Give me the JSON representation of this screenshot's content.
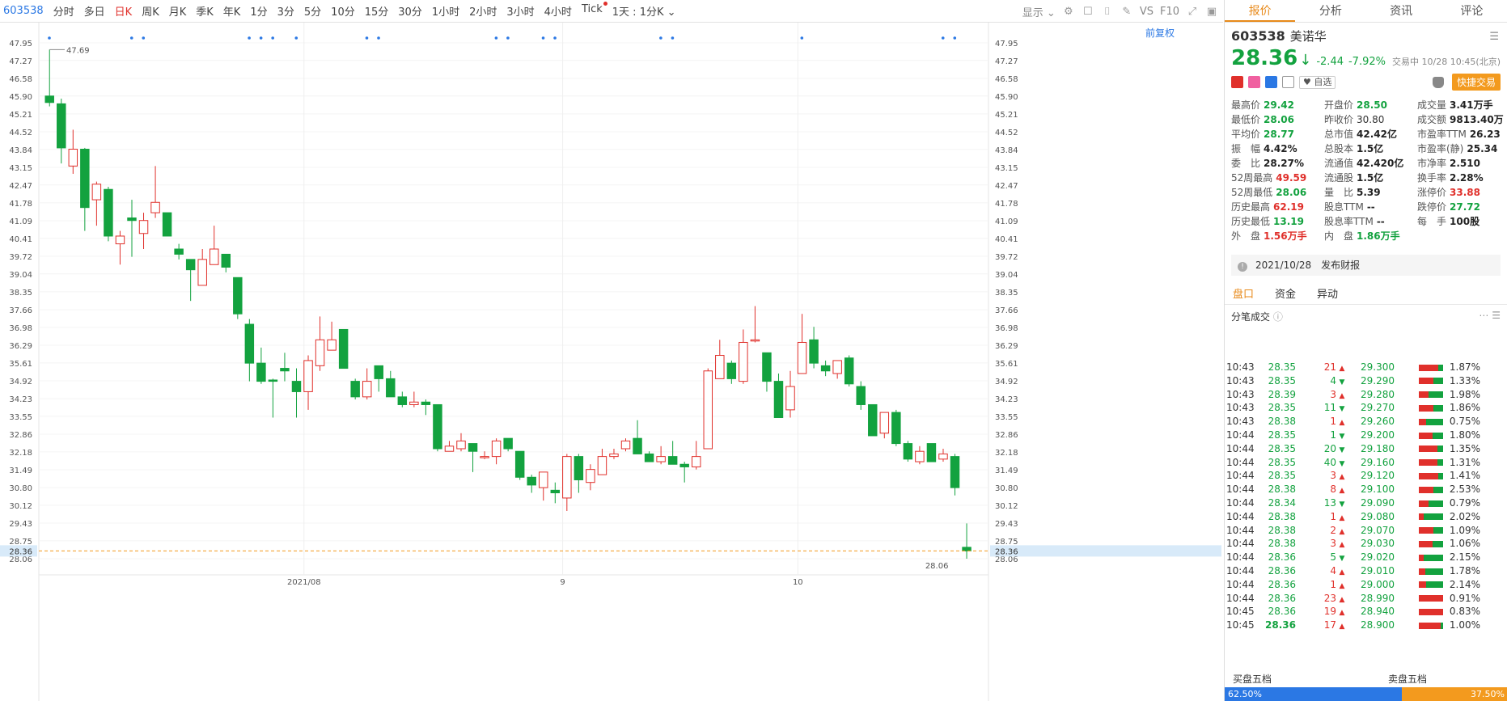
{
  "toolbar": {
    "code": "603538",
    "periods": [
      "分时",
      "多日",
      "日K",
      "周K",
      "月K",
      "季K",
      "年K",
      "1分",
      "3分",
      "5分",
      "10分",
      "15分",
      "30分",
      "1小时",
      "2小时",
      "3小时",
      "4小时",
      "Tick"
    ],
    "active_period": "日K",
    "dotted_periods": [
      "Tick"
    ],
    "interval": "1天 : 1分K",
    "display_label": "显示",
    "vs_label": "VS",
    "f10_label": "F10"
  },
  "chart": {
    "restore_label": "前复权",
    "axis_levels": [
      "47.95",
      "47.27",
      "46.58",
      "45.90",
      "45.21",
      "44.52",
      "43.84",
      "43.15",
      "42.47",
      "41.78",
      "41.09",
      "40.41",
      "39.72",
      "39.04",
      "38.35",
      "37.66",
      "36.98",
      "36.29",
      "35.61",
      "34.92",
      "34.23",
      "33.55",
      "32.86",
      "32.18",
      "31.49",
      "30.80",
      "30.12",
      "29.43",
      "28.75",
      "28.06"
    ],
    "current_price_label": "28.36",
    "max_label": "47.69",
    "min_label": "28.06",
    "date_labels": [
      {
        "text": "2021/08",
        "index": 22
      },
      {
        "text": "9",
        "index": 44
      },
      {
        "text": "10",
        "index": 64
      }
    ]
  },
  "chart_data": {
    "type": "candlestick",
    "ylim": [
      28.06,
      47.95
    ],
    "current_price": 28.36,
    "candles": [
      {
        "o": 45.9,
        "c": 45.65,
        "h": 47.69,
        "l": 45.5
      },
      {
        "o": 45.6,
        "c": 43.9,
        "h": 45.8,
        "l": 43.3
      },
      {
        "o": 43.2,
        "c": 43.85,
        "h": 44.6,
        "l": 42.9
      },
      {
        "o": 43.85,
        "c": 41.6,
        "h": 43.9,
        "l": 40.7
      },
      {
        "o": 41.9,
        "c": 42.5,
        "h": 42.6,
        "l": 40.9
      },
      {
        "o": 42.3,
        "c": 40.5,
        "h": 42.4,
        "l": 40.3
      },
      {
        "o": 40.2,
        "c": 40.5,
        "h": 40.7,
        "l": 39.4
      },
      {
        "o": 41.2,
        "c": 41.1,
        "h": 41.9,
        "l": 39.7
      },
      {
        "o": 40.6,
        "c": 41.1,
        "h": 41.4,
        "l": 40.0
      },
      {
        "o": 41.4,
        "c": 41.8,
        "h": 43.2,
        "l": 41.2
      },
      {
        "o": 41.4,
        "c": 40.5,
        "h": 41.4,
        "l": 40.5
      },
      {
        "o": 40.0,
        "c": 39.8,
        "h": 40.2,
        "l": 39.6
      },
      {
        "o": 39.6,
        "c": 39.2,
        "h": 39.6,
        "l": 38.0
      },
      {
        "o": 38.6,
        "c": 39.6,
        "h": 40.0,
        "l": 38.6
      },
      {
        "o": 39.4,
        "c": 40.0,
        "h": 40.9,
        "l": 39.4
      },
      {
        "o": 39.8,
        "c": 39.3,
        "h": 39.8,
        "l": 39.1
      },
      {
        "o": 38.9,
        "c": 37.5,
        "h": 38.9,
        "l": 37.3
      },
      {
        "o": 37.1,
        "c": 35.6,
        "h": 37.3,
        "l": 34.9
      },
      {
        "o": 35.6,
        "c": 34.9,
        "h": 36.2,
        "l": 34.8
      },
      {
        "o": 34.95,
        "c": 34.9,
        "h": 35.0,
        "l": 33.5
      },
      {
        "o": 35.4,
        "c": 35.3,
        "h": 36.0,
        "l": 34.9
      },
      {
        "o": 34.9,
        "c": 34.5,
        "h": 35.4,
        "l": 33.5
      },
      {
        "o": 34.5,
        "c": 35.7,
        "h": 35.9,
        "l": 33.8
      },
      {
        "o": 35.5,
        "c": 36.5,
        "h": 37.4,
        "l": 35.3
      },
      {
        "o": 36.1,
        "c": 36.5,
        "h": 37.2,
        "l": 36.1
      },
      {
        "o": 36.9,
        "c": 35.4,
        "h": 36.9,
        "l": 35.4
      },
      {
        "o": 34.9,
        "c": 34.3,
        "h": 35.0,
        "l": 34.2
      },
      {
        "o": 34.3,
        "c": 34.9,
        "h": 35.4,
        "l": 34.2
      },
      {
        "o": 35.5,
        "c": 35.0,
        "h": 35.5,
        "l": 34.5
      },
      {
        "o": 35.0,
        "c": 34.3,
        "h": 35.3,
        "l": 34.3
      },
      {
        "o": 34.3,
        "c": 34.0,
        "h": 34.5,
        "l": 33.9
      },
      {
        "o": 34.0,
        "c": 34.1,
        "h": 34.5,
        "l": 33.9
      },
      {
        "o": 34.1,
        "c": 34.0,
        "h": 34.2,
        "l": 33.6
      },
      {
        "o": 34.0,
        "c": 32.3,
        "h": 34.0,
        "l": 32.2
      },
      {
        "o": 32.2,
        "c": 32.4,
        "h": 32.6,
        "l": 32.2
      },
      {
        "o": 32.3,
        "c": 32.6,
        "h": 32.9,
        "l": 32.2
      },
      {
        "o": 32.5,
        "c": 32.2,
        "h": 32.5,
        "l": 31.4
      },
      {
        "o": 32.0,
        "c": 32.0,
        "h": 32.2,
        "l": 31.9
      },
      {
        "o": 32.0,
        "c": 32.6,
        "h": 32.7,
        "l": 31.7
      },
      {
        "o": 32.7,
        "c": 32.3,
        "h": 32.7,
        "l": 32.2
      },
      {
        "o": 32.2,
        "c": 31.2,
        "h": 32.2,
        "l": 31.1
      },
      {
        "o": 31.2,
        "c": 30.9,
        "h": 31.3,
        "l": 30.6
      },
      {
        "o": 30.8,
        "c": 31.4,
        "h": 31.4,
        "l": 30.3
      },
      {
        "o": 30.7,
        "c": 30.6,
        "h": 31.0,
        "l": 30.2
      },
      {
        "o": 30.4,
        "c": 32.0,
        "h": 32.1,
        "l": 29.9
      },
      {
        "o": 32.0,
        "c": 31.1,
        "h": 32.1,
        "l": 30.6
      },
      {
        "o": 31.0,
        "c": 31.5,
        "h": 31.7,
        "l": 30.7
      },
      {
        "o": 31.3,
        "c": 32.0,
        "h": 32.3,
        "l": 31.3
      },
      {
        "o": 32.0,
        "c": 32.1,
        "h": 32.3,
        "l": 31.9
      },
      {
        "o": 32.3,
        "c": 32.6,
        "h": 32.7,
        "l": 32.2
      },
      {
        "o": 32.7,
        "c": 32.1,
        "h": 33.4,
        "l": 32.1
      },
      {
        "o": 32.1,
        "c": 31.8,
        "h": 32.2,
        "l": 31.8
      },
      {
        "o": 31.8,
        "c": 32.0,
        "h": 32.4,
        "l": 31.7
      },
      {
        "o": 32.0,
        "c": 31.7,
        "h": 32.6,
        "l": 31.8
      },
      {
        "o": 31.7,
        "c": 31.6,
        "h": 31.8,
        "l": 31.0
      },
      {
        "o": 31.6,
        "c": 32.0,
        "h": 32.6,
        "l": 31.5
      },
      {
        "o": 32.3,
        "c": 35.3,
        "h": 35.4,
        "l": 32.3
      },
      {
        "o": 35.0,
        "c": 35.9,
        "h": 36.5,
        "l": 35.0
      },
      {
        "o": 35.6,
        "c": 35.0,
        "h": 35.7,
        "l": 34.8
      },
      {
        "o": 34.9,
        "c": 36.4,
        "h": 36.9,
        "l": 34.8
      },
      {
        "o": 36.5,
        "c": 36.5,
        "h": 37.8,
        "l": 36.4
      },
      {
        "o": 36.0,
        "c": 34.9,
        "h": 36.0,
        "l": 34.5
      },
      {
        "o": 34.9,
        "c": 33.5,
        "h": 35.2,
        "l": 33.5
      },
      {
        "o": 33.8,
        "c": 34.7,
        "h": 35.3,
        "l": 33.5
      },
      {
        "o": 35.2,
        "c": 36.4,
        "h": 37.5,
        "l": 35.2
      },
      {
        "o": 36.5,
        "c": 35.6,
        "h": 37.0,
        "l": 35.4
      },
      {
        "o": 35.5,
        "c": 35.3,
        "h": 35.7,
        "l": 35.1
      },
      {
        "o": 35.2,
        "c": 35.7,
        "h": 35.7,
        "l": 35.0
      },
      {
        "o": 35.8,
        "c": 34.8,
        "h": 35.9,
        "l": 34.7
      },
      {
        "o": 34.7,
        "c": 34.0,
        "h": 34.9,
        "l": 33.8
      },
      {
        "o": 34.0,
        "c": 32.8,
        "h": 34.0,
        "l": 32.8
      },
      {
        "o": 32.9,
        "c": 33.7,
        "h": 33.7,
        "l": 32.7
      },
      {
        "o": 33.7,
        "c": 32.5,
        "h": 33.8,
        "l": 32.4
      },
      {
        "o": 32.5,
        "c": 31.9,
        "h": 32.6,
        "l": 31.8
      },
      {
        "o": 31.8,
        "c": 32.2,
        "h": 32.4,
        "l": 31.7
      },
      {
        "o": 32.5,
        "c": 31.8,
        "h": 32.5,
        "l": 31.8
      },
      {
        "o": 31.9,
        "c": 32.1,
        "h": 32.3,
        "l": 31.8
      },
      {
        "o": 32.0,
        "c": 30.8,
        "h": 32.1,
        "l": 30.5
      },
      {
        "o": 28.5,
        "c": 28.36,
        "h": 29.42,
        "l": 28.06
      }
    ],
    "up_color": "#e0302b",
    "down_color": "#13a23f"
  },
  "quote": {
    "tabs": [
      "报价",
      "分析",
      "资讯",
      "评论"
    ],
    "active_tab": "报价",
    "code": "603538",
    "name": "美诺华",
    "price": "28.36",
    "change": "-2.44",
    "change_pct": "-7.92%",
    "time": "交易中 10/28 10:45(北京)",
    "fav_label": "自选",
    "quick_trade": "快捷交易",
    "stats": [
      {
        "k": "最高价",
        "v": "29.42",
        "c": "green"
      },
      {
        "k": "开盘价",
        "v": "28.50",
        "c": "green"
      },
      {
        "k": "成交量",
        "v": "3.41万手",
        "c": "blk"
      },
      {
        "k": "最低价",
        "v": "28.06",
        "c": "green"
      },
      {
        "k": "昨收价",
        "v": "30.80",
        "c": "normal"
      },
      {
        "k": "成交额",
        "v": "9813.40万",
        "c": "blk"
      },
      {
        "k": "平均价",
        "v": "28.77",
        "c": "green"
      },
      {
        "k": "总市值",
        "v": "42.42亿",
        "c": "blk"
      },
      {
        "k": "市盈率TTM",
        "v": "26.23",
        "c": "blk"
      },
      {
        "k": "振　幅",
        "v": "4.42%",
        "c": "blk"
      },
      {
        "k": "总股本",
        "v": "1.5亿",
        "c": "blk"
      },
      {
        "k": "市盈率(静)",
        "v": "25.34",
        "c": "blk"
      },
      {
        "k": "委　比",
        "v": "28.27%",
        "c": "blk"
      },
      {
        "k": "流通值",
        "v": "42.420亿",
        "c": "blk"
      },
      {
        "k": "市净率",
        "v": "2.510",
        "c": "blk"
      },
      {
        "k": "52周最高",
        "v": "49.59",
        "c": "red"
      },
      {
        "k": "流通股",
        "v": "1.5亿",
        "c": "blk"
      },
      {
        "k": "换手率",
        "v": "2.28%",
        "c": "blk"
      },
      {
        "k": "52周最低",
        "v": "28.06",
        "c": "green"
      },
      {
        "k": "量　比",
        "v": "5.39",
        "c": "blk"
      },
      {
        "k": "涨停价",
        "v": "33.88",
        "c": "red"
      },
      {
        "k": "历史最高",
        "v": "62.19",
        "c": "red"
      },
      {
        "k": "股息TTM",
        "v": "--",
        "c": "blk"
      },
      {
        "k": "跌停价",
        "v": "27.72",
        "c": "green"
      },
      {
        "k": "历史最低",
        "v": "13.19",
        "c": "green"
      },
      {
        "k": "股息率TTM",
        "v": "--",
        "c": "blk"
      },
      {
        "k": "每　手",
        "v": "100股",
        "c": "blk"
      },
      {
        "k": "外　盘",
        "v": "1.56万手",
        "c": "red"
      },
      {
        "k": "内　盘",
        "v": "1.86万手",
        "c": "green"
      }
    ],
    "announcement": "2021/10/28　发布财报"
  },
  "depth": {
    "tabs": [
      "盘口",
      "资金",
      "异动"
    ],
    "active_tab": "盘口",
    "trades_title": "分笔成交",
    "trades": [
      {
        "t": "10:43",
        "p": "28.35",
        "q": "21",
        "d": "up"
      },
      {
        "t": "10:43",
        "p": "28.35",
        "q": "4",
        "d": "down"
      },
      {
        "t": "10:43",
        "p": "28.39",
        "q": "3",
        "d": "up"
      },
      {
        "t": "10:43",
        "p": "28.35",
        "q": "11",
        "d": "down"
      },
      {
        "t": "10:43",
        "p": "28.38",
        "q": "1",
        "d": "up"
      },
      {
        "t": "10:44",
        "p": "28.35",
        "q": "1",
        "d": "down"
      },
      {
        "t": "10:44",
        "p": "28.35",
        "q": "20",
        "d": "down"
      },
      {
        "t": "10:44",
        "p": "28.35",
        "q": "40",
        "d": "down"
      },
      {
        "t": "10:44",
        "p": "28.35",
        "q": "3",
        "d": "up"
      },
      {
        "t": "10:44",
        "p": "28.38",
        "q": "8",
        "d": "up"
      },
      {
        "t": "10:44",
        "p": "28.34",
        "q": "13",
        "d": "down"
      },
      {
        "t": "10:44",
        "p": "28.38",
        "q": "1",
        "d": "up"
      },
      {
        "t": "10:44",
        "p": "28.38",
        "q": "2",
        "d": "up"
      },
      {
        "t": "10:44",
        "p": "28.38",
        "q": "3",
        "d": "up"
      },
      {
        "t": "10:44",
        "p": "28.36",
        "q": "5",
        "d": "down"
      },
      {
        "t": "10:44",
        "p": "28.36",
        "q": "4",
        "d": "up"
      },
      {
        "t": "10:44",
        "p": "28.36",
        "q": "1",
        "d": "up"
      },
      {
        "t": "10:44",
        "p": "28.36",
        "q": "23",
        "d": "up"
      },
      {
        "t": "10:45",
        "p": "28.36",
        "q": "19",
        "d": "up"
      },
      {
        "t": "10:45",
        "p": "28.36",
        "q": "17",
        "d": "up"
      }
    ],
    "levels": [
      {
        "p": "29.300",
        "pct": "1.87%",
        "r": 0.8
      },
      {
        "p": "29.290",
        "pct": "1.33%",
        "r": 0.6
      },
      {
        "p": "29.280",
        "pct": "1.98%",
        "r": 0.4
      },
      {
        "p": "29.270",
        "pct": "1.86%",
        "r": 0.6
      },
      {
        "p": "29.260",
        "pct": "0.75%",
        "r": 0.3
      },
      {
        "p": "29.200",
        "pct": "1.80%",
        "r": 0.55
      },
      {
        "p": "29.180",
        "pct": "1.35%",
        "r": 0.75
      },
      {
        "p": "29.160",
        "pct": "1.31%",
        "r": 0.75
      },
      {
        "p": "29.120",
        "pct": "1.41%",
        "r": 0.8
      },
      {
        "p": "29.100",
        "pct": "2.53%",
        "r": 0.6
      },
      {
        "p": "29.090",
        "pct": "0.79%",
        "r": 0.4
      },
      {
        "p": "29.080",
        "pct": "2.02%",
        "r": 0.2
      },
      {
        "p": "29.070",
        "pct": "1.09%",
        "r": 0.6
      },
      {
        "p": "29.030",
        "pct": "1.06%",
        "r": 0.55
      },
      {
        "p": "29.020",
        "pct": "2.15%",
        "r": 0.2
      },
      {
        "p": "29.010",
        "pct": "1.78%",
        "r": 0.25
      },
      {
        "p": "29.000",
        "pct": "2.14%",
        "r": 0.3
      },
      {
        "p": "28.990",
        "pct": "0.91%",
        "r": 1.0
      },
      {
        "p": "28.940",
        "pct": "0.83%",
        "r": 1.0
      },
      {
        "p": "28.900",
        "pct": "1.00%",
        "r": 0.9
      }
    ],
    "buy5_label": "买盘五档",
    "sell5_label": "卖盘五档",
    "buy_pct": "62.50%",
    "sell_pct": "37.50%",
    "buy_ratio": 0.625
  }
}
